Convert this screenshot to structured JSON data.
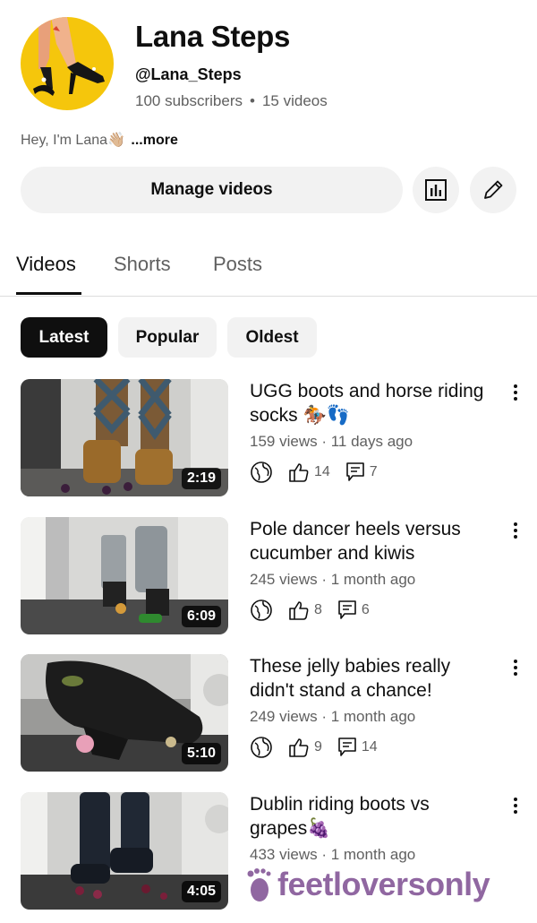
{
  "channel": {
    "name": "Lana Steps",
    "handle": "@Lana_Steps",
    "subscribers": "100 subscribers",
    "videos_count": "15 videos",
    "about": "Hey,  I'm Lana👋🏼",
    "more_label": "...more"
  },
  "actions": {
    "manage_label": "Manage videos",
    "analytics_icon": "analytics-icon",
    "edit_icon": "pencil-icon"
  },
  "tabs": [
    {
      "label": "Videos",
      "active": true
    },
    {
      "label": "Shorts",
      "active": false
    },
    {
      "label": "Posts",
      "active": false
    }
  ],
  "chips": [
    {
      "label": "Latest",
      "active": true
    },
    {
      "label": "Popular",
      "active": false
    },
    {
      "label": "Oldest",
      "active": false
    }
  ],
  "videos": [
    {
      "title": "UGG boots and horse riding socks 🏇👣",
      "duration": "2:19",
      "views": "159 views",
      "age": "11 days ago",
      "likes": "14",
      "comments": "7"
    },
    {
      "title": "Pole dancer heels versus cucumber and kiwis",
      "duration": "6:09",
      "views": "245 views",
      "age": "1 month ago",
      "likes": "8",
      "comments": "6"
    },
    {
      "title": "These jelly babies really didn't stand a chance!",
      "duration": "5:10",
      "views": "249 views",
      "age": "1 month ago",
      "likes": "9",
      "comments": "14"
    },
    {
      "title": "Dublin riding boots vs grapes🍇",
      "duration": "4:05",
      "views": "433 views",
      "age": "1 month ago",
      "likes": "",
      "comments": ""
    }
  ],
  "watermark": "feetloversonly",
  "colors": {
    "text": "#0f0f0f",
    "secondary": "#606060",
    "chip_bg": "#f2f2f2",
    "avatar_bg": "#f5c60c"
  }
}
